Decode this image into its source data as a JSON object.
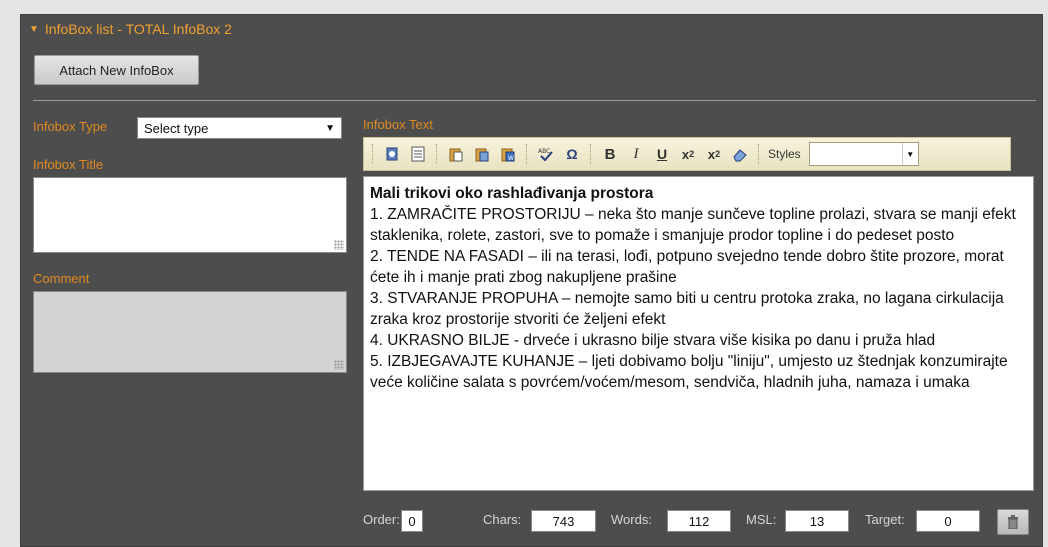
{
  "header": {
    "title": "InfoBox list - TOTAL InfoBox 2"
  },
  "attach_button": "Attach New InfoBox",
  "form": {
    "type_label": "Infobox Type",
    "type_value": "Select type",
    "title_label": "Infobox Title",
    "comment_label": "Comment",
    "text_label": "Infobox Text"
  },
  "toolbar": {
    "buttons": [
      "source-icon",
      "document-icon",
      "paste-icon",
      "paste-text-icon",
      "paste-word-icon",
      "spellcheck-icon",
      "special-char-icon",
      "bold-icon",
      "italic-icon",
      "underline-icon",
      "subscript-icon",
      "superscript-icon",
      "remove-format-icon"
    ],
    "styles_label": "Styles"
  },
  "editor": {
    "title": "Mali trikovi oko rashlađivanja prostora",
    "paragraphs": [
      "1. ZAMRAČITE PROSTORIJU – neka što manje sunčeve topline prolazi, stvara se manji efekt staklenika, rolete, zastori, sve to pomaže i smanjuje prodor topline i do pedeset posto",
      "2. TENDE NA FASADI – ili na terasi, lođi, potpuno svejedno tende dobro štite prozore, morat ćete ih i manje prati zbog nakupljene prašine",
      "3. STVARANJE PROPUHA – nemojte samo biti u centru protoka zraka, no lagana cirkulacija zraka kroz prostorije stvoriti će željeni efekt",
      "4. UKRASNO BILJE - drveće i ukrasno bilje stvara više kisika po danu i pruža hlad",
      "5. IZBJEGAVAJTE KUHANJE – ljeti dobivamo bolju \"liniju\", umjesto uz štednjak konzumirajte veće količine salata s povrćem/voćem/mesom, sendviča, hladnih juha, namaza i umaka"
    ]
  },
  "footer": {
    "order_label": "Order:",
    "order_value": "0",
    "chars_label": "Chars:",
    "chars_value": "743",
    "words_label": "Words:",
    "words_value": "112",
    "msl_label": "MSL:",
    "msl_value": "13",
    "target_label": "Target:",
    "target_value": "0"
  }
}
